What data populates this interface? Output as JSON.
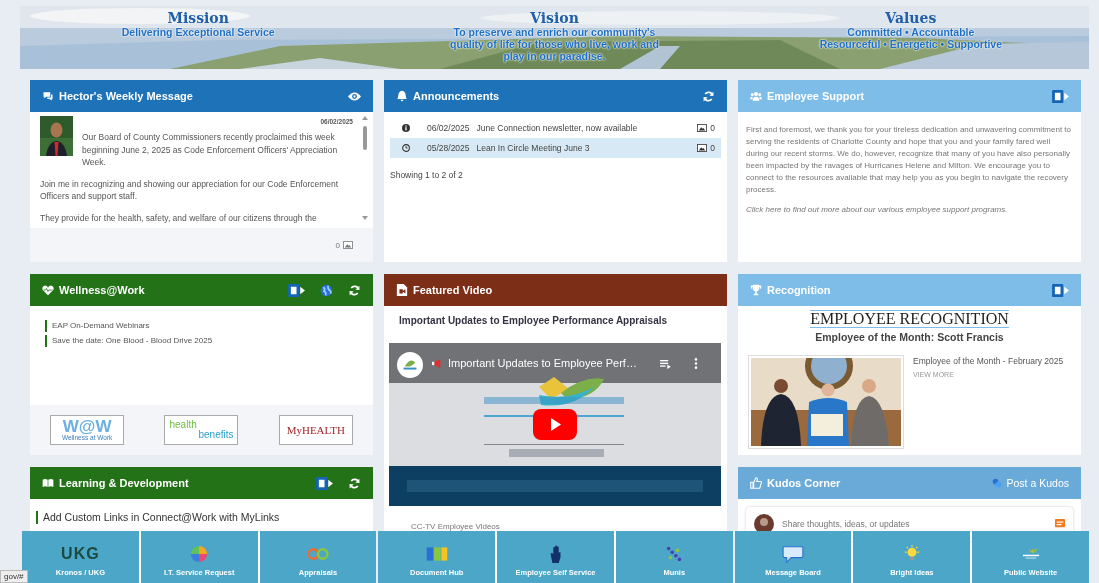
{
  "banner": {
    "columns": [
      {
        "heading": "Mission",
        "lines": [
          "Delivering Exceptional Service"
        ]
      },
      {
        "heading": "Vision",
        "lines": [
          "To preserve and enrich our community's",
          "quality of life for those who live, work and",
          "play in our paradise."
        ]
      },
      {
        "heading": "Values",
        "lines": [
          "Committed • Accountable",
          "Resourceful • Energetic • Supportive"
        ]
      }
    ]
  },
  "weekly_message": {
    "title": "Hector's Weekly Message",
    "date": "06/02/2025",
    "paragraphs": [
      "Our Board of County Commissioners recently proclaimed this week beginning June 2, 2025 as Code Enforcement Officers' Appreciation Week.",
      "Join me in recognizing and showing our appreciation for our Code Enforcement Officers and support staff.",
      "They provide for the health, safety, and welfare of our citizens through the"
    ],
    "footer_count": "0"
  },
  "announcements": {
    "title": "Announcements",
    "items": [
      {
        "kind": "info",
        "date": "06/02/2025",
        "title": "June Connection newsletter, now available",
        "count": "0",
        "selected": false
      },
      {
        "kind": "clock",
        "date": "05/28/2025",
        "title": "Lean In Circle Meeting June 3",
        "count": "0",
        "selected": true
      }
    ],
    "summary": "Showing 1 to 2 of 2"
  },
  "employee_support": {
    "title": "Employee Support",
    "text": "First and foremost, we thank you for your tireless dedication and unwavering commitment to serving the residents of Charlotte County and hope that you and your family fared well during our recent storms. We do, however, recognize that many of you have also personally been impacted by the ravages of Hurricanes Helene and Milton. We encourage you to connect to the resources available that may help you as you begin to navigate the recovery process.",
    "link": "Click here to find out more about our various employee support programs."
  },
  "wellness": {
    "title": "Wellness@Work",
    "links": [
      "EAP On-Demand Webinars",
      "Save the date: One Blood - Blood Drive 2025"
    ],
    "logos": [
      {
        "kind": "wow",
        "text": "W@W",
        "subtext": "Wellness at Work"
      },
      {
        "kind": "health",
        "text": "health",
        "subtext": "benefits"
      },
      {
        "kind": "myhealth",
        "text": "MyHEALTH"
      }
    ]
  },
  "learning": {
    "title": "Learning & Development",
    "links": [
      "Add Custom Links in Connect@Work with MyLinks"
    ]
  },
  "featured_video": {
    "title": "Featured Video",
    "video_title": "Important Updates to Employee Performance Appraisals",
    "player_title": "Important Updates to Employee Perf…",
    "channel": "CC-TV Employee Videos"
  },
  "recognition": {
    "title": "Recognition",
    "heading": "EMPLOYEE RECOGNITION",
    "subheading": "Employee of the Month: Scott Francis",
    "caption": "Employee of the Month - February 2025",
    "link": "VIEW MORE"
  },
  "kudos": {
    "title": "Kudos Corner",
    "action": "Post a Kudos",
    "placeholder": "Share thoughts, ideas, or updates"
  },
  "dock": [
    {
      "kind": "ukg",
      "label": "Kronos / UKG",
      "logo_text": "UKG"
    },
    {
      "kind": "it",
      "label": "I.T. Service Request"
    },
    {
      "kind": "appraisals",
      "label": "Appraisals"
    },
    {
      "kind": "documents",
      "label": "Document Hub"
    },
    {
      "kind": "self",
      "label": "Employee Self Service"
    },
    {
      "kind": "munis",
      "label": "Munis"
    },
    {
      "kind": "message",
      "label": "Message Board"
    },
    {
      "kind": "ideas",
      "label": "Bright Ideas"
    },
    {
      "kind": "website",
      "label": "Public Website"
    }
  ],
  "status_url": "gov/#"
}
